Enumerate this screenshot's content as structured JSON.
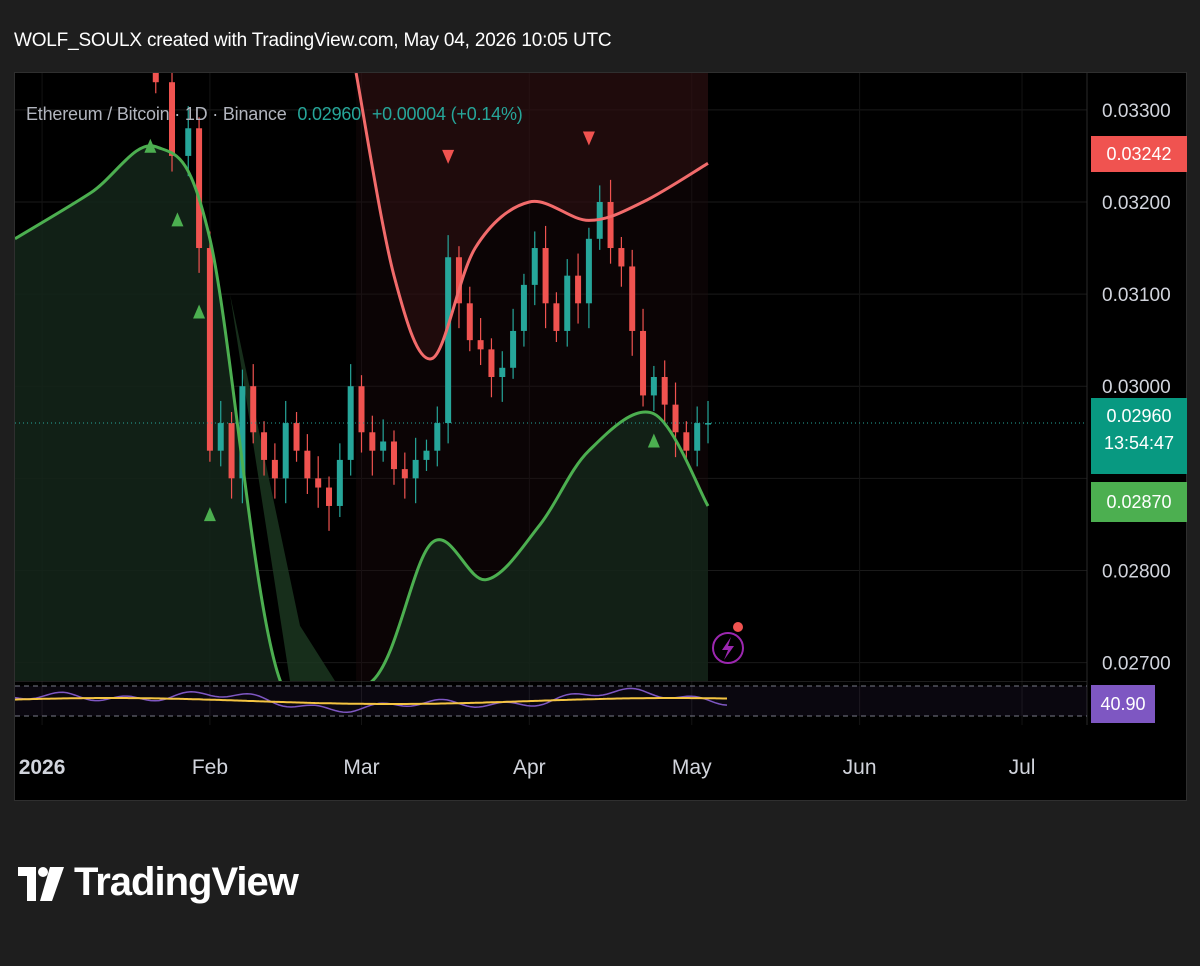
{
  "header": {
    "text": "WOLF_SOULX created with TradingView.com, May 04, 2026 10:05 UTC"
  },
  "legend": {
    "symbol": "Ethereum / Bitcoin · 1D · Binance",
    "last": "0.02960",
    "change": "+0.00004 (+0.14%)"
  },
  "price_axis": {
    "labels": [
      "0.03300",
      "0.03200",
      "0.03100",
      "0.03000",
      "0.02800",
      "0.02700"
    ],
    "tags": {
      "upper": {
        "value": "0.03242",
        "color": "#f05350"
      },
      "current": {
        "value": "0.02960",
        "countdown": "13:54:47",
        "color": "#089981"
      },
      "lower": {
        "value": "0.02870",
        "color": "#4caf50"
      }
    }
  },
  "rsi": {
    "value": "40.90",
    "color": "#7e57c2"
  },
  "time_axis": {
    "labels": [
      "2026",
      "Feb",
      "Mar",
      "Apr",
      "May",
      "Jun",
      "Jul"
    ]
  },
  "logo": {
    "text": "TradingView"
  },
  "colors": {
    "up": "#26a69a",
    "down": "#f05350",
    "band_upper": "#f26b6b",
    "band_lower": "#4caf50",
    "rsi_line": "#7e57c2",
    "rsi_ma": "#f5c542"
  },
  "chart_data": {
    "type": "candlestick",
    "interval": "1D",
    "ylim": [
      0.0268,
      0.0334
    ],
    "x_range": [
      "2025-12-27",
      "2026-07-13"
    ],
    "last_price": 0.0296,
    "closes": [
      {
        "date": "2026-01-22",
        "close": 0.0333
      },
      {
        "date": "2026-01-25",
        "close": 0.0325
      },
      {
        "date": "2026-01-28",
        "close": 0.0328
      },
      {
        "date": "2026-01-30",
        "close": 0.0315
      },
      {
        "date": "2026-02-01",
        "close": 0.0293
      },
      {
        "date": "2026-02-03",
        "close": 0.0296
      },
      {
        "date": "2026-02-05",
        "close": 0.029
      },
      {
        "date": "2026-02-07",
        "close": 0.03
      },
      {
        "date": "2026-02-09",
        "close": 0.0295
      },
      {
        "date": "2026-02-11",
        "close": 0.0292
      },
      {
        "date": "2026-02-13",
        "close": 0.029
      },
      {
        "date": "2026-02-15",
        "close": 0.0296
      },
      {
        "date": "2026-02-17",
        "close": 0.0293
      },
      {
        "date": "2026-02-19",
        "close": 0.029
      },
      {
        "date": "2026-02-21",
        "close": 0.0289
      },
      {
        "date": "2026-02-23",
        "close": 0.0287
      },
      {
        "date": "2026-02-25",
        "close": 0.0292
      },
      {
        "date": "2026-02-27",
        "close": 0.03
      },
      {
        "date": "2026-03-01",
        "close": 0.0295
      },
      {
        "date": "2026-03-03",
        "close": 0.0293
      },
      {
        "date": "2026-03-05",
        "close": 0.0294
      },
      {
        "date": "2026-03-07",
        "close": 0.0291
      },
      {
        "date": "2026-03-09",
        "close": 0.029
      },
      {
        "date": "2026-03-11",
        "close": 0.0292
      },
      {
        "date": "2026-03-13",
        "close": 0.0293
      },
      {
        "date": "2026-03-15",
        "close": 0.0296
      },
      {
        "date": "2026-03-17",
        "close": 0.0314
      },
      {
        "date": "2026-03-19",
        "close": 0.0309
      },
      {
        "date": "2026-03-21",
        "close": 0.0305
      },
      {
        "date": "2026-03-23",
        "close": 0.0304
      },
      {
        "date": "2026-03-25",
        "close": 0.0301
      },
      {
        "date": "2026-03-27",
        "close": 0.0302
      },
      {
        "date": "2026-03-29",
        "close": 0.0306
      },
      {
        "date": "2026-03-31",
        "close": 0.0311
      },
      {
        "date": "2026-04-02",
        "close": 0.0315
      },
      {
        "date": "2026-04-04",
        "close": 0.0309
      },
      {
        "date": "2026-04-06",
        "close": 0.0306
      },
      {
        "date": "2026-04-08",
        "close": 0.0312
      },
      {
        "date": "2026-04-10",
        "close": 0.0309
      },
      {
        "date": "2026-04-12",
        "close": 0.0316
      },
      {
        "date": "2026-04-14",
        "close": 0.032
      },
      {
        "date": "2026-04-16",
        "close": 0.0315
      },
      {
        "date": "2026-04-18",
        "close": 0.0313
      },
      {
        "date": "2026-04-20",
        "close": 0.0306
      },
      {
        "date": "2026-04-22",
        "close": 0.0299
      },
      {
        "date": "2026-04-24",
        "close": 0.0301
      },
      {
        "date": "2026-04-26",
        "close": 0.0298
      },
      {
        "date": "2026-04-28",
        "close": 0.0295
      },
      {
        "date": "2026-04-30",
        "close": 0.0293
      },
      {
        "date": "2026-05-02",
        "close": 0.0296
      },
      {
        "date": "2026-05-04",
        "close": 0.0296
      }
    ],
    "upper_band": [
      {
        "date": "2026-02-28",
        "value": 0.0334
      },
      {
        "date": "2026-03-07",
        "value": 0.0312
      },
      {
        "date": "2026-03-14",
        "value": 0.0303
      },
      {
        "date": "2026-03-22",
        "value": 0.0315
      },
      {
        "date": "2026-04-01",
        "value": 0.032
      },
      {
        "date": "2026-04-12",
        "value": 0.0318
      },
      {
        "date": "2026-04-22",
        "value": 0.032
      },
      {
        "date": "2026-05-04",
        "value": 0.03242
      }
    ],
    "lower_band": [
      {
        "date": "2025-12-27",
        "value": 0.0316
      },
      {
        "date": "2026-01-10",
        "value": 0.0321
      },
      {
        "date": "2026-01-22",
        "value": 0.0326
      },
      {
        "date": "2026-02-01",
        "value": 0.0316
      },
      {
        "date": "2026-02-14",
        "value": 0.0268
      },
      {
        "date": "2026-03-03",
        "value": 0.0268
      },
      {
        "date": "2026-03-14",
        "value": 0.0283
      },
      {
        "date": "2026-03-24",
        "value": 0.0279
      },
      {
        "date": "2026-04-03",
        "value": 0.0285
      },
      {
        "date": "2026-04-12",
        "value": 0.0293
      },
      {
        "date": "2026-04-24",
        "value": 0.0297
      },
      {
        "date": "2026-05-04",
        "value": 0.0287
      }
    ],
    "signals": [
      {
        "date": "2026-01-21",
        "type": "buy"
      },
      {
        "date": "2026-01-26",
        "type": "buy"
      },
      {
        "date": "2026-01-30",
        "type": "buy"
      },
      {
        "date": "2026-02-01",
        "type": "buy"
      },
      {
        "date": "2026-03-17",
        "type": "sell"
      },
      {
        "date": "2026-04-12",
        "type": "sell"
      },
      {
        "date": "2026-04-24",
        "type": "buy"
      }
    ],
    "rsi": {
      "value": 40.9
    }
  }
}
